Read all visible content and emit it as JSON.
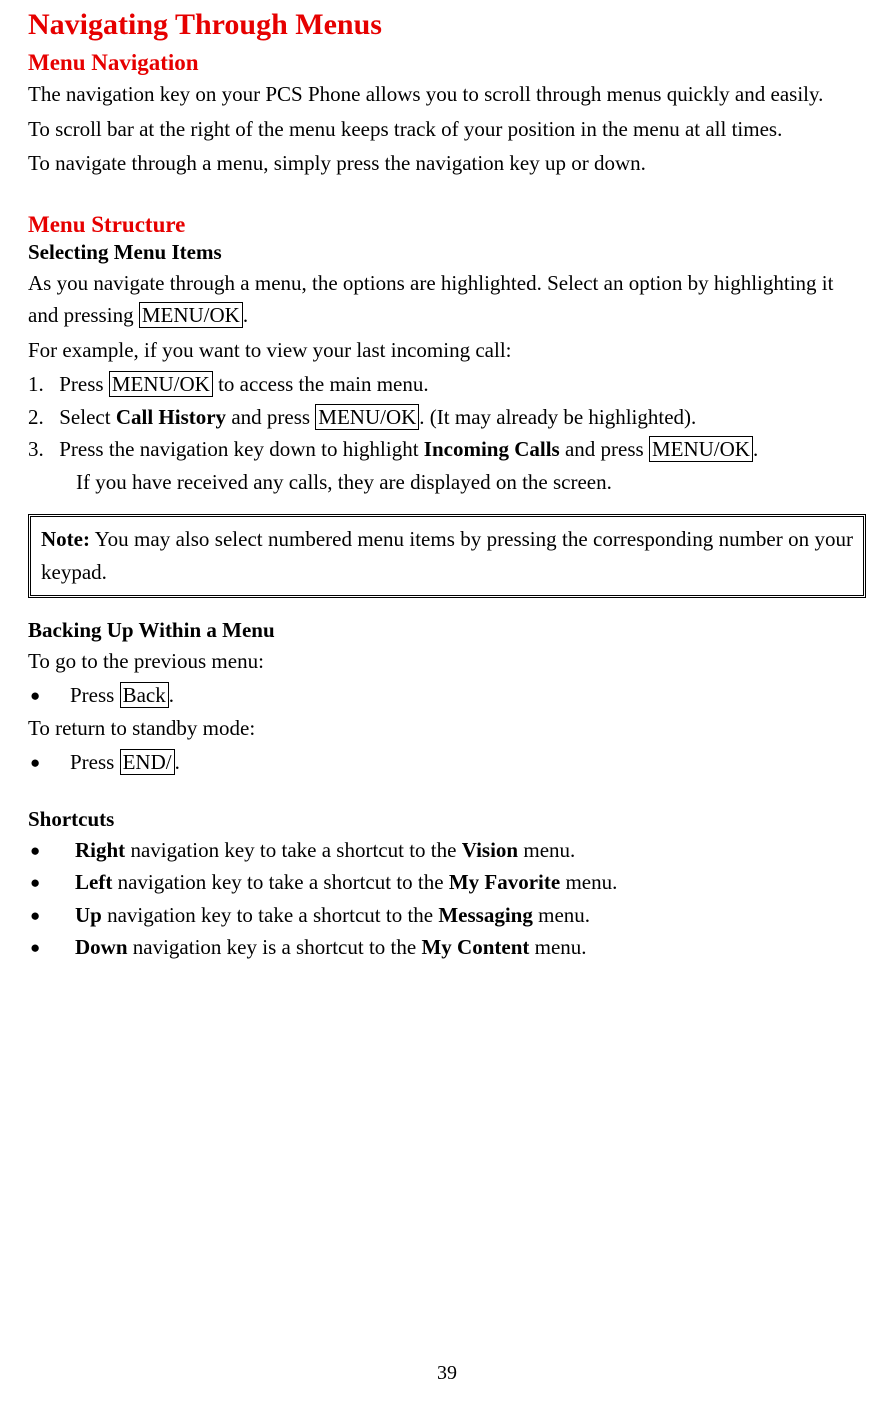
{
  "title": "Navigating Through Menus",
  "sec1": {
    "heading": "Menu Navigation",
    "p1": "The navigation key on your PCS Phone allows you to scroll through menus quickly and easily.",
    "p2": "To scroll bar at the right of the menu keeps track of your position in the menu at all times.",
    "p3": "To navigate through a menu, simply press the navigation key up or down."
  },
  "sec2": {
    "heading": "Menu Structure",
    "sub1": {
      "heading": "Selecting Menu Items",
      "intro_a": "As you navigate through a menu, the options are highlighted. Select an option by highlighting it and pressing ",
      "key_menuok": "MENU/OK",
      "intro_b": ".",
      "example_lead": "For example, if you want to view your last incoming call:",
      "step1_a": "Press ",
      "step1_b": " to access the main menu.",
      "step2_a": "Select ",
      "step2_bold": "Call History",
      "step2_b": " and press ",
      "step2_c": ". (It may already be highlighted).",
      "step3_a": "Press the navigation key down to highlight ",
      "step3_bold": "Incoming Calls",
      "step3_b": " and press ",
      "step3_c": ".",
      "step3_cont": "If you have received any calls, they are displayed on the screen.",
      "num1": "1.",
      "num2": "2.",
      "num3": "3."
    },
    "note": {
      "label": "Note:",
      "text": " You may also select numbered menu items by pressing the corresponding number on your keypad."
    },
    "sub2": {
      "heading": "Backing Up Within a Menu",
      "prev_lead": "To go to the previous menu:",
      "b1_a": "Press ",
      "key_back": "Back",
      "b1_b": ".",
      "standby_lead": "To return to standby mode:",
      "b2_a": "Press ",
      "key_end": "END/",
      "b2_b": "."
    },
    "sub3": {
      "heading": "Shortcuts",
      "s1_bold": "Right",
      "s1_a": " navigation key to take a shortcut to the ",
      "s1_bold2": "Vision",
      "s1_b": " menu.",
      "s2_bold": "Left",
      "s2_a": " navigation key to take a shortcut to the ",
      "s2_bold2": "My Favorite",
      "s2_b": " menu.",
      "s3_bold": "Up",
      "s3_a": " navigation key to take a shortcut to the ",
      "s3_bold2": "Messaging",
      "s3_b": " menu.",
      "s4_bold": "Down",
      "s4_a": " navigation key is a shortcut to the ",
      "s4_bold2": "My Content",
      "s4_b": " menu."
    }
  },
  "page_number": "39"
}
